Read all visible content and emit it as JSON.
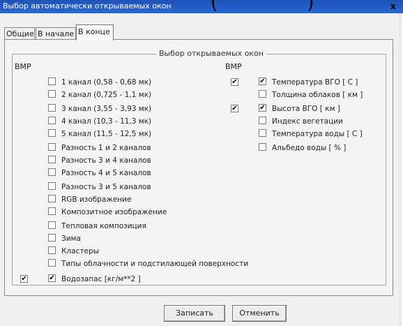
{
  "window": {
    "title": "Выбор автоматически открываемых окон",
    "title_overflow": "(  )",
    "close": "x"
  },
  "tabs": [
    {
      "label": "Общие",
      "active": false
    },
    {
      "label": "В начале",
      "active": false
    },
    {
      "label": "В конце",
      "active": true
    }
  ],
  "group": {
    "legend": "Выбор открываемых окон"
  },
  "left_column": {
    "header": "ВМР",
    "items": [
      {
        "label": "1 канал (0,58 - 0,68 мк)",
        "checked": false,
        "vmp_checked": false
      },
      {
        "label": "2 канал (0,725 - 1,1 мк)",
        "checked": false,
        "vmp_checked": false
      },
      {
        "label": "3 канал (3,55 - 3,93 мк)",
        "checked": false,
        "vmp_checked": false
      },
      {
        "label": "4 канал (10,3 - 11,3 мк)",
        "checked": false,
        "vmp_checked": false
      },
      {
        "label": "5 канал (11,5 - 12,5 мк)",
        "checked": false,
        "vmp_checked": false
      },
      {
        "label": "Разность 1 и 2 каналов",
        "checked": false,
        "vmp_checked": false
      },
      {
        "label": "Разность 3 и 4 каналов",
        "checked": false,
        "vmp_checked": false
      },
      {
        "label": "Разность 4 и 5 каналов",
        "checked": false,
        "vmp_checked": false
      },
      {
        "label": "Разность 3 и 5 каналов",
        "checked": false,
        "vmp_checked": false
      },
      {
        "label": "RGB изображение",
        "checked": false,
        "vmp_checked": false
      },
      {
        "label": "Композитное изображение",
        "checked": false,
        "vmp_checked": false
      },
      {
        "label": "Тепловая композиция",
        "checked": false,
        "vmp_checked": false
      },
      {
        "label": "Зима",
        "checked": false,
        "vmp_checked": false
      },
      {
        "label": "Кластеры",
        "checked": false,
        "vmp_checked": false
      },
      {
        "label": "Типы облачности и подстилающей поверхности",
        "checked": false,
        "vmp_checked": false
      },
      {
        "label": "Водозапас [кг/м**2 ]",
        "checked": true,
        "vmp_checked": true
      }
    ]
  },
  "right_column": {
    "header": "ВМР",
    "items": [
      {
        "label": "Температура ВГО [ С ]",
        "checked": true,
        "vmp_checked": true
      },
      {
        "label": "Толщина облаков [ км ]",
        "checked": false,
        "vmp_checked": false
      },
      {
        "label": "Высота ВГО [ км ]",
        "checked": true,
        "vmp_checked": true
      },
      {
        "label": "Индекс вегетации",
        "checked": false,
        "vmp_checked": false
      },
      {
        "label": "Температура воды [ С ]",
        "checked": false,
        "vmp_checked": false
      },
      {
        "label": "Альбедо воды [ % ]",
        "checked": false,
        "vmp_checked": false
      }
    ]
  },
  "buttons": {
    "save": "Записать",
    "cancel": "Отменить"
  },
  "check_glyph": "✔"
}
